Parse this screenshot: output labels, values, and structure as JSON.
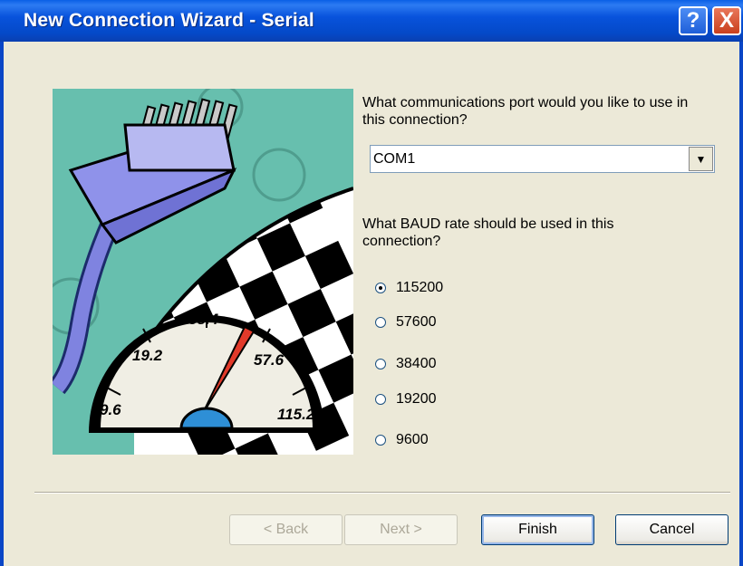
{
  "window": {
    "title": "New Connection Wizard - Serial",
    "help_glyph": "?",
    "close_glyph": "X"
  },
  "illustration": {
    "gauge_labels": [
      "9.6",
      "19.2",
      "38.4",
      "57.6",
      "115.2"
    ],
    "icons": [
      "serial-connector-icon",
      "speedometer-icon",
      "checkered-flag-icon"
    ]
  },
  "port_question": "What communications port would you like to use in this connection?",
  "port_select": {
    "value": "COM1"
  },
  "baud_question": "What BAUD rate should be used in this connection?",
  "baud_options": [
    {
      "label": "115200",
      "checked": true
    },
    {
      "label": "57600",
      "checked": false
    },
    {
      "label": "38400",
      "checked": false
    },
    {
      "label": "19200",
      "checked": false
    },
    {
      "label": "9600",
      "checked": false
    }
  ],
  "buttons": {
    "back": "< Back",
    "next": "Next >",
    "finish": "Finish",
    "cancel": "Cancel"
  }
}
